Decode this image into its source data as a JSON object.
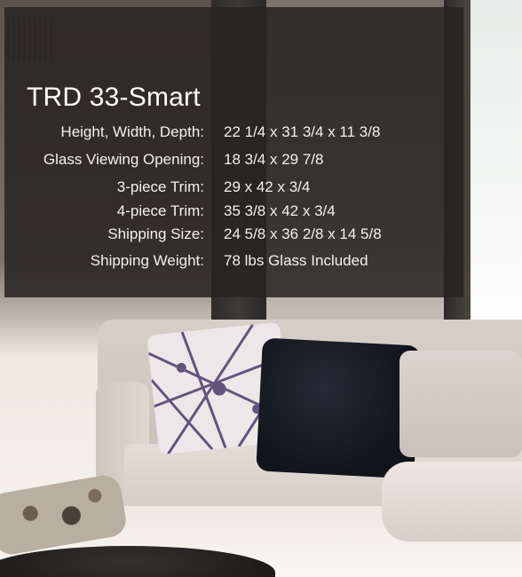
{
  "product": {
    "title": "TRD 33-Smart"
  },
  "specs": [
    {
      "label": "Height, Width, Depth:",
      "value": "22 1/4 x 31 3/4 x 11 3/8"
    },
    {
      "label": "Glass Viewing Opening:",
      "value": "18 3/4 x 29 7/8"
    },
    {
      "label": "3-piece Trim:",
      "value": "29 x 42 x 3/4"
    },
    {
      "label": "4-piece Trim:",
      "value": "35 3/8 x 42 x 3/4"
    },
    {
      "label": "Shipping Size:",
      "value": "24 5/8 x 36 2/8 x 14 5/8"
    },
    {
      "label": "Shipping Weight:",
      "value": "78 lbs Glass Included"
    }
  ],
  "colors": {
    "panel": "#262322",
    "text": "#ffffff"
  }
}
